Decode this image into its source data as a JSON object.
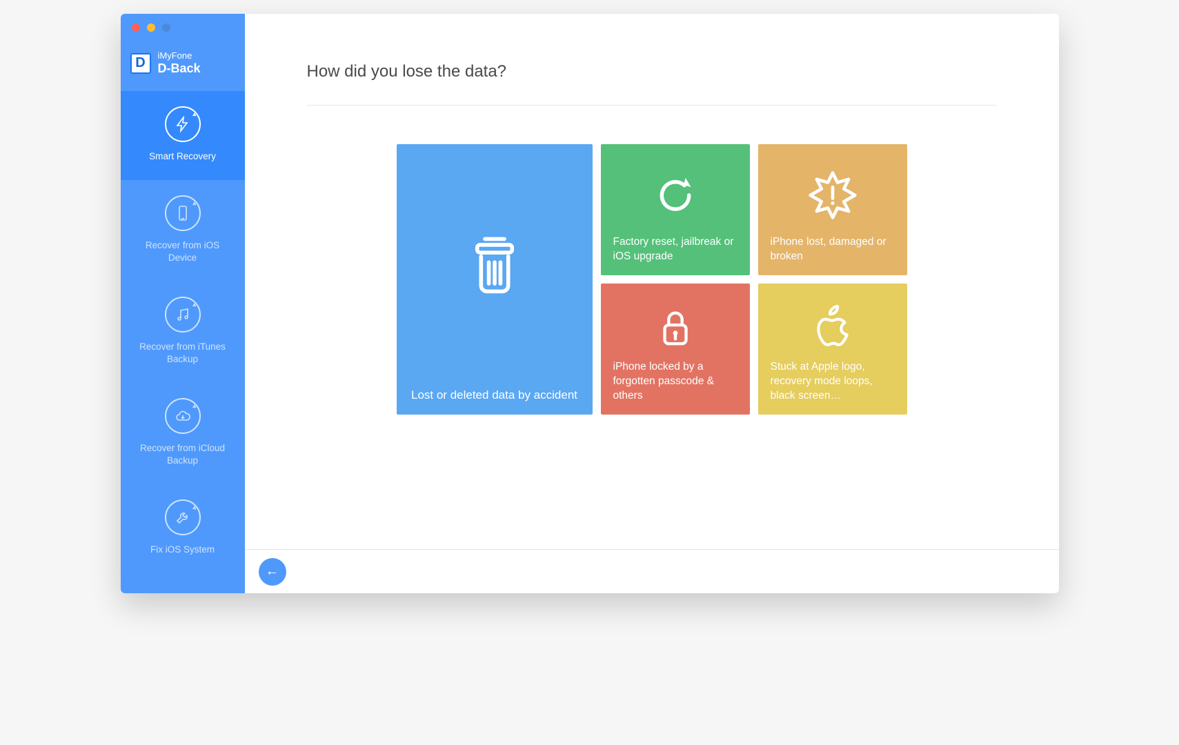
{
  "brand": {
    "logo_letter": "D",
    "line1": "iMyFone",
    "line2": "D-Back"
  },
  "sidebar": {
    "items": [
      {
        "id": "smart-recovery",
        "label": "Smart Recovery",
        "icon": "lightning-icon",
        "active": true
      },
      {
        "id": "recover-ios-device",
        "label": "Recover from iOS Device",
        "icon": "phone-icon",
        "active": false
      },
      {
        "id": "recover-itunes-backup",
        "label": "Recover from iTunes Backup",
        "icon": "music-icon",
        "active": false
      },
      {
        "id": "recover-icloud-backup",
        "label": "Recover from iCloud Backup",
        "icon": "cloud-icon",
        "active": false
      },
      {
        "id": "fix-ios-system",
        "label": "Fix iOS System",
        "icon": "wrench-icon",
        "active": false
      }
    ]
  },
  "page": {
    "title": "How did you lose the data?"
  },
  "tiles": [
    {
      "id": "accident",
      "label": "Lost or deleted data by accident",
      "icon": "trash-icon",
      "color": "t-blue",
      "layout": "big"
    },
    {
      "id": "factory-reset",
      "label": "Factory reset, jailbreak or iOS upgrade",
      "icon": "restore-icon",
      "color": "t-green",
      "layout": "small"
    },
    {
      "id": "lost-broken",
      "label": "iPhone lost, damaged or broken",
      "icon": "burst-icon",
      "color": "t-orange",
      "layout": "small"
    },
    {
      "id": "locked",
      "label": "iPhone locked by a forgotten passcode & others",
      "icon": "lock-icon",
      "color": "t-red",
      "layout": "small"
    },
    {
      "id": "stuck-logo",
      "label": "Stuck at Apple logo, recovery mode loops, black screen…",
      "icon": "apple-icon",
      "color": "t-yellow",
      "layout": "small"
    }
  ],
  "footer": {
    "back_label": "Back"
  }
}
